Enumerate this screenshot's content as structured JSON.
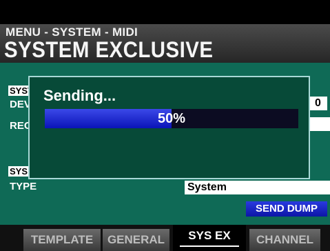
{
  "header": {
    "breadcrumb": "MENU - SYSTEM - MIDI",
    "title": "SYSTEM EXCLUSIVE"
  },
  "main": {
    "section1_label": "SYST",
    "device_label": "DEV",
    "device_value": "0",
    "rec_label": "REC",
    "section2_label": "SYS",
    "type_label": "TYPE",
    "type_value": "System",
    "send_dump_label": "SEND DUMP"
  },
  "dialog": {
    "title": "Sending...",
    "progress_text": "50%",
    "progress": 0.5
  },
  "tabs": [
    {
      "label": "TEMPLATE",
      "active": false
    },
    {
      "label": "GENERAL",
      "active": false
    },
    {
      "label": "SYS EX",
      "active": true
    },
    {
      "label": "CHANNEL",
      "active": false
    }
  ],
  "colors": {
    "background": "#0f6a56",
    "dialog": "#074a38",
    "accent_blue": "#1a27c9"
  }
}
